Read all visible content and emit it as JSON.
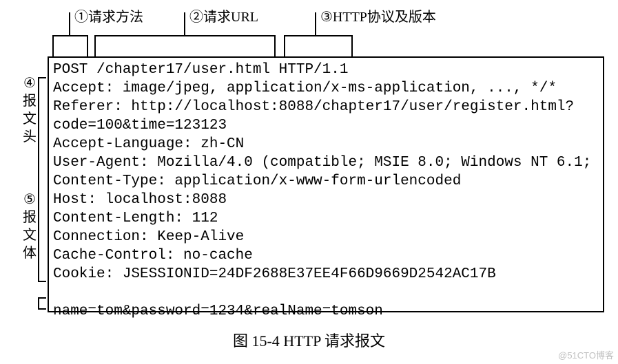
{
  "title": "图 15-4  HTTP 请求报文",
  "watermark": "@51CTO博客",
  "labels": {
    "top1": "①请求方法",
    "top2": "②请求URL",
    "top3": "③HTTP协议及版本",
    "side4_a": "④",
    "side4_b": "报",
    "side4_c": "文",
    "side4_d": "头",
    "side5_a": "⑤",
    "side5_b": "报",
    "side5_c": "文",
    "side5_d": "体"
  },
  "message": {
    "line1": "POST /chapter17/user.html HTTP/1.1",
    "line2": "Accept: image/jpeg, application/x-ms-application, ..., */*",
    "line3": "Referer: http://localhost:8088/chapter17/user/register.html?",
    "line4": "code=100&time=123123",
    "line5": "Accept-Language: zh-CN",
    "line6": "User-Agent: Mozilla/4.0 (compatible; MSIE 8.0; Windows NT 6.1;",
    "line7": "Content-Type: application/x-www-form-urlencoded",
    "line8": "Host: localhost:8088",
    "line9": "Content-Length: 112",
    "line10": "Connection: Keep-Alive",
    "line11": "Cache-Control: no-cache",
    "line12": "Cookie: JSESSIONID=24DF2688E37EE4F66D9669D2542AC17B",
    "line13": "",
    "line14": "name=tom&password=1234&realName=tomson"
  }
}
